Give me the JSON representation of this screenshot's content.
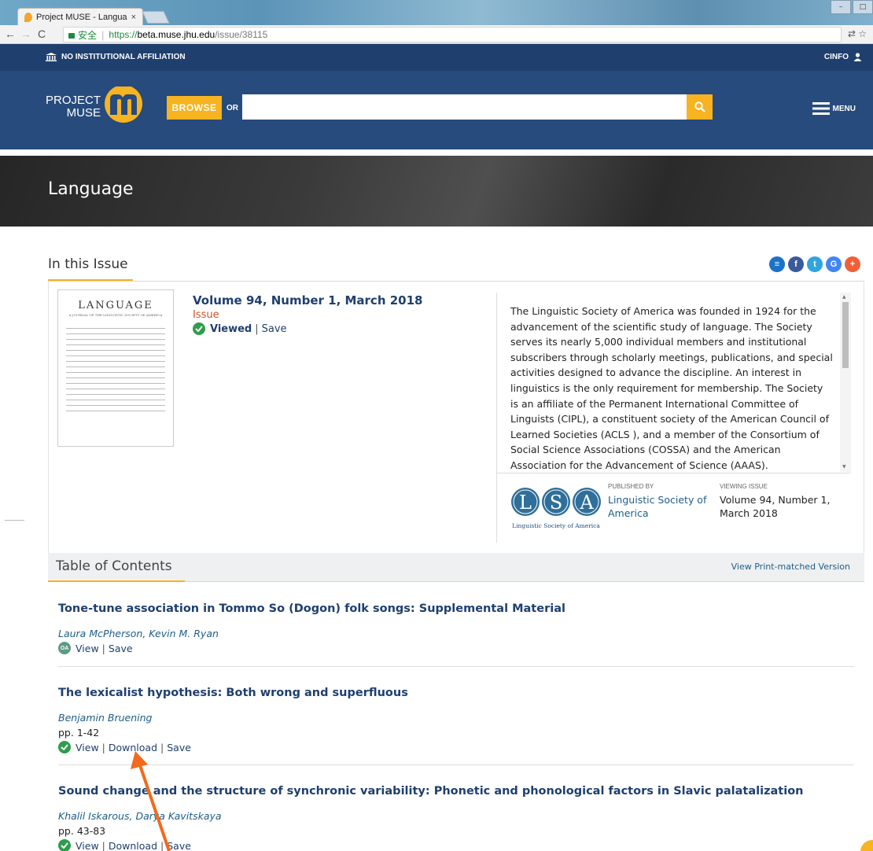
{
  "browser": {
    "tab_title": "Project MUSE - Langua",
    "tab_close": "×",
    "secure_label": "安全",
    "url_protocol": "https://",
    "url_host": "beta.muse.jhu.edu",
    "url_path": "/issue/38115"
  },
  "header": {
    "affiliation": "NO INSTITUTIONAL AFFILIATION",
    "user": "CINFO",
    "logo_line1": "PROJECT",
    "logo_line2": "MUSE",
    "browse_label": "BROWSE",
    "or_label": "OR",
    "search_placeholder": "",
    "menu_label": "MENU"
  },
  "journal": {
    "title": "Language"
  },
  "issue": {
    "section_title": "In this Issue",
    "cover_title": "LANGUAGE",
    "cover_subtitle": "A JOURNAL OF THE LINGUISTIC SOCIETY OF AMERICA",
    "volume": "Volume 94, Number 1, March 2018",
    "type": "Issue",
    "viewed_label": "Viewed",
    "save_label": "Save",
    "description": "The Linguistic Society of America was founded in 1924 for the advancement of the scientific study of language. The Society serves its nearly 5,000 individual members and institutional subscribers through scholarly meetings, publications, and special activities designed to advance the discipline. An interest in linguistics is the only requirement for membership. The Society is an affiliate of the Permanent International Committee of Linguists (CIPL), a constituent society of the American Council of Learned Societies (ACLS ), and a member of the Consortium of Social Science Associations (COSSA) and the American Association for the Advancement of Science (AAAS).",
    "publisher_label": "PUBLISHED BY",
    "publisher_name": "Linguistic Society of America",
    "logo_caption": "Linguistic Society of America",
    "viewing_label": "VIEWING ISSUE",
    "viewing_value": "Volume 94, Number 1, March 2018"
  },
  "toc": {
    "title": "Table of Contents",
    "print_link": "View Print-matched Version",
    "articles": [
      {
        "title": "Tone-tune association in Tommo So (Dogon) folk songs: Supplemental Material",
        "authors": "Laura McPherson, Kevin M. Ryan",
        "pages": "",
        "badge": "OA",
        "view": "View",
        "download": "",
        "save": "Save"
      },
      {
        "title": "The lexicalist hypothesis: Both wrong and superfluous",
        "authors": "Benjamin Bruening",
        "pages": "pp. 1-42",
        "badge": "",
        "view": "View",
        "download": "Download",
        "save": "Save"
      },
      {
        "title": "Sound change and the structure of synchronic variability: Phonetic and phonological factors in Slavic palatalization",
        "authors": "Khalil Iskarous, Darya Kavitskaya",
        "pages": "pp. 43-83",
        "badge": "",
        "view": "View",
        "download": "Download",
        "save": "Save"
      }
    ]
  },
  "share_icons": [
    "list-icon",
    "facebook-icon",
    "twitter-icon",
    "google-icon",
    "plus-icon"
  ],
  "colors": {
    "navy": "#1f3f6e",
    "header_blue": "#274b7c",
    "accent_gold": "#f7b320",
    "issue_orange": "#d4532a",
    "viewed_green": "#2e9d4a",
    "annotation_arrow": "#f26a1b"
  }
}
